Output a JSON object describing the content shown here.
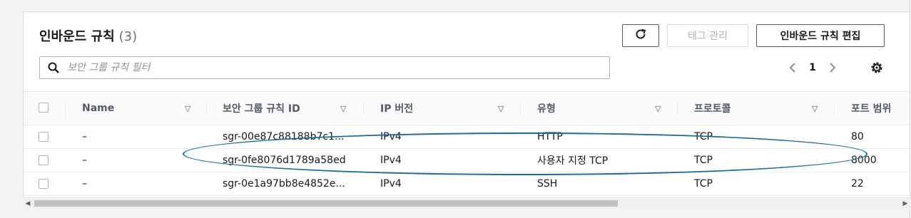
{
  "header": {
    "title": "인바운드 규칙",
    "count": "(3)",
    "refresh_icon": "refresh-icon",
    "manage_tags_label": "태그 관리",
    "edit_label": "인바운드 규칙 편집"
  },
  "search": {
    "placeholder": "보안 그룹 규칙 필터",
    "icon": "search-icon"
  },
  "pagination": {
    "current_page": "1",
    "prev_icon": "chevron-left-icon",
    "next_icon": "chevron-right-icon",
    "settings_icon": "gear-icon"
  },
  "table": {
    "columns": [
      "Name",
      "보안 그룹 규칙 ID",
      "IP 버전",
      "유형",
      "프로토콜",
      "포트 범위"
    ],
    "rows": [
      {
        "name": "–",
        "rule_id": "sgr-00e87c88188b7c1...",
        "ip_version": "IPv4",
        "type": "HTTP",
        "protocol": "TCP",
        "port_range": "80"
      },
      {
        "name": "–",
        "rule_id": "sgr-0fe8076d1789a58ed",
        "ip_version": "IPv4",
        "type": "사용자 지정 TCP",
        "protocol": "TCP",
        "port_range": "8000"
      },
      {
        "name": "–",
        "rule_id": "sgr-0e1a97bb8e4852e...",
        "ip_version": "IPv4",
        "type": "SSH",
        "protocol": "TCP",
        "port_range": "22"
      }
    ]
  },
  "colors": {
    "highlight_ellipse": "#1a6e93",
    "border": "#d5dbdb"
  }
}
